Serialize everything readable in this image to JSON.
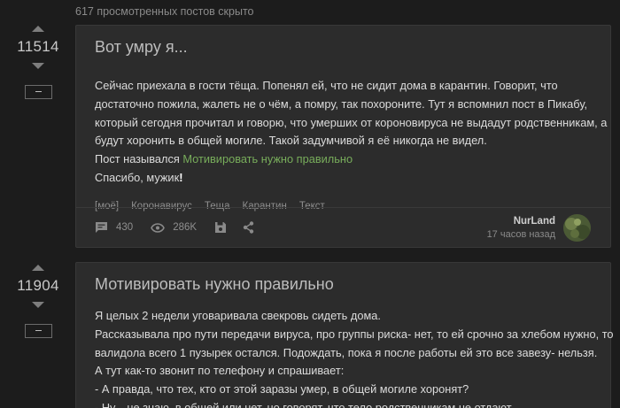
{
  "hidden_note": "617 просмотренных постов скрыто",
  "posts": [
    {
      "rating": "11514",
      "title": "Вот умру я...",
      "lines": [
        "Сейчас приехала в гости тёща. Попенял ей, что не сидит дома в карантин. Говорит, что",
        "достаточно пожила, жалеть не о чём, а помру, так похороните. Тут я вспомнил пост в Пикабу,",
        "который сегодня прочитал и говорю, что умерших от короновируса не выдадут родственникам, а",
        "будут хоронить в общей могиле. Такой задумчивой я её никогда не видел."
      ],
      "link_prefix": "Пост назывался ",
      "link_text": "Мотивировать нужно правильно",
      "closing": "Спасибо, мужик",
      "closing_mark": "!",
      "tags": [
        "[моё]",
        "Коронавирус",
        "Теща",
        "Карантин",
        "Текст"
      ],
      "comments": "430",
      "views": "286K",
      "author": "NurLand",
      "time": "17 часов назад"
    },
    {
      "rating": "11904",
      "title": "Мотивировать нужно правильно",
      "lines": [
        "Я целых 2 недели уговаривала свекровь сидеть дома.",
        "Рассказывала про пути передачи вируса, про группы риска- нет, то ей срочно за хлебом нужно, то",
        "валидола всего 1 пузырек остался. Подождать, пока я после работы ей это все завезу- нельзя.",
        "А тут как-то звонит по телефону и спрашивает:",
        "- А правда, что тех, кто от этой заразы умер, в общей могиле хоронят?",
        "- Ну... не знаю, в общей или нет, но говорят, что тело родственникам не отдают."
      ]
    }
  ],
  "icons": {
    "upvote": "arrow-up-icon",
    "downvote": "arrow-down-icon",
    "collapse": "minus-icon",
    "comments": "comment-icon",
    "views": "eye-icon",
    "save": "save-icon",
    "share": "share-icon"
  },
  "colors": {
    "background": "#1c1c1c",
    "card": "#2c2c2c",
    "link": "#78ad5b"
  }
}
